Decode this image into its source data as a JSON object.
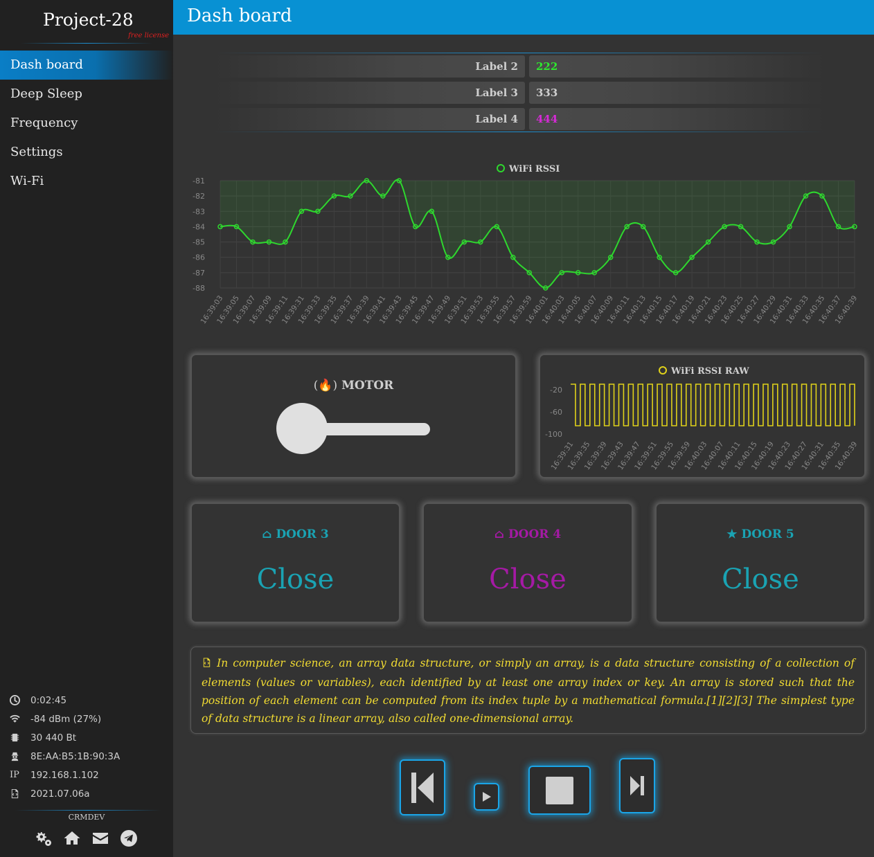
{
  "app": {
    "title": "Project-28",
    "license": "free license",
    "page_title": "Dash board"
  },
  "menu": [
    {
      "label": "Dash board",
      "active": true
    },
    {
      "label": "Deep Sleep",
      "active": false
    },
    {
      "label": "Frequency",
      "active": false
    },
    {
      "label": "Settings",
      "active": false
    },
    {
      "label": "Wi-Fi",
      "active": false
    }
  ],
  "system": {
    "uptime": "0:02:45",
    "signal": "-84 dBm (27%)",
    "memory": "30 440 Bt",
    "mac": "8E:AA:B5:1B:90:3A",
    "ip_label": "IP",
    "ip": "192.168.1.102",
    "version": "2021.07.06a",
    "vendor": "CRMDEV"
  },
  "labels": [
    {
      "name": "Label 2",
      "value": "222",
      "color": "#2ee82e"
    },
    {
      "name": "Label 3",
      "value": "333",
      "color": "#cfcfcf"
    },
    {
      "name": "Label 4",
      "value": "444",
      "color": "#d62ad6"
    }
  ],
  "rssi_chart": {
    "chart_data": {
      "type": "line",
      "title": "",
      "series": [
        {
          "name": "WiFi RSSI",
          "color": "#2ed82e",
          "values": [
            -84,
            -84,
            -85,
            -85,
            -85,
            -83,
            -83,
            -82,
            -82,
            -81,
            -82,
            -81,
            -84,
            -83,
            -86,
            -85,
            -85,
            -84,
            -86,
            -87,
            -88,
            -87,
            -87,
            -87,
            -86,
            -84,
            -84,
            -86,
            -87,
            -86,
            -85,
            -84,
            -84,
            -85,
            -85,
            -84,
            -82,
            -82,
            -84,
            -84
          ]
        }
      ],
      "x": [
        "16:39:03",
        "16:39:05",
        "16:39:07",
        "16:39:09",
        "16:39:11",
        "16:39:31",
        "16:39:33",
        "16:39:35",
        "16:39:37",
        "16:39:39",
        "16:39:41",
        "16:39:43",
        "16:39:45",
        "16:39:47",
        "16:39:49",
        "16:39:51",
        "16:39:53",
        "16:39:55",
        "16:39:57",
        "16:39:59",
        "16:40:01",
        "16:40:03",
        "16:40:05",
        "16:40:07",
        "16:40:09",
        "16:40:11",
        "16:40:13",
        "16:40:15",
        "16:40:17",
        "16:40:19",
        "16:40:21",
        "16:40:23",
        "16:40:25",
        "16:40:27",
        "16:40:29",
        "16:40:31",
        "16:40:33",
        "16:40:35",
        "16:40:37",
        "16:40:39"
      ],
      "ylim": [
        -88,
        -81
      ],
      "yticks": [
        -81,
        -82,
        -83,
        -84,
        -85,
        -86,
        -87,
        -88
      ],
      "grid": true,
      "legend": "top"
    }
  },
  "motor": {
    "title": "MOTOR",
    "toggle_on": false
  },
  "raw_chart": {
    "chart_data": {
      "type": "line",
      "title": "",
      "series": [
        {
          "name": "WiFi RSSI RAW",
          "color": "#e0d21a",
          "values": [
            -10,
            -85,
            -10,
            -85,
            -10,
            -85,
            -10,
            -85,
            -10,
            -85,
            -10,
            -85,
            -10,
            -85,
            -10,
            -85,
            -10,
            -85,
            -10,
            -85,
            -10,
            -85,
            -10,
            -85,
            -10,
            -85,
            -10,
            -85,
            -10,
            -85,
            -10,
            -85,
            -10,
            -85,
            -10,
            -85,
            -10,
            -85,
            -10,
            -85,
            -10,
            -85,
            -10,
            -85,
            -10,
            -85,
            -10,
            -85,
            -10,
            -85,
            -10,
            -85,
            -10,
            -85,
            -10,
            -85,
            -10,
            -85,
            -10,
            -85
          ]
        }
      ],
      "x": [
        "16:39:31",
        "16:39:35",
        "16:39:39",
        "16:39:43",
        "16:39:47",
        "16:39:51",
        "16:39:55",
        "16:39:59",
        "16:40:03",
        "16:40:07",
        "16:40:11",
        "16:40:15",
        "16:40:19",
        "16:40:23",
        "16:40:27",
        "16:40:31",
        "16:40:35",
        "16:40:39"
      ],
      "ylim": [
        -100,
        -10
      ],
      "yticks": [
        -20,
        -60,
        -100
      ],
      "grid": false,
      "legend": "top"
    }
  },
  "doors": [
    {
      "title": "DOOR 3",
      "status": "Close",
      "color": "#1aa3b3",
      "icon": "home-icon"
    },
    {
      "title": "DOOR 4",
      "status": "Close",
      "color": "#a51aa5",
      "icon": "home-icon"
    },
    {
      "title": "DOOR 5",
      "status": "Close",
      "color": "#1aa3b3",
      "icon": "star-icon"
    }
  ],
  "description": "In computer science, an array data structure, or simply an array, is a data structure consisting of a collection of elements (values or variables), each identified by at least one array index or key. An array is stored such that the position of each element can be computed from its index tuple by a mathematical formula.[1][2][3] The simplest type of data structure is a linear array, also called one-dimensional array."
}
